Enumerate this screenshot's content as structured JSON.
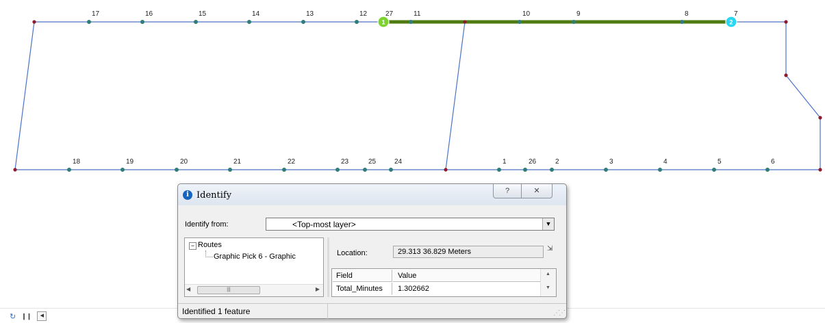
{
  "colors": {
    "network_line": "#4a73c9",
    "route": "#4e7a12",
    "node": "#2f7d75",
    "vertex": "#8c1c2e",
    "stop1": "#7dd32e",
    "stop2": "#2ad6f1"
  },
  "map": {
    "top_labels": [
      "17",
      "16",
      "15",
      "14",
      "13",
      "12",
      "27",
      "11",
      "10",
      "9",
      "8",
      "7"
    ],
    "bottom_labels": [
      "18",
      "19",
      "20",
      "21",
      "22",
      "23",
      "25",
      "24",
      "1",
      "26",
      "2",
      "3",
      "4",
      "5",
      "6"
    ],
    "stops": [
      {
        "label": "1"
      },
      {
        "label": "2"
      }
    ]
  },
  "identify": {
    "title": "Identify",
    "help_glyph": "?",
    "close_glyph": "✕",
    "from_label": "Identify from:",
    "from_value": "<Top-most layer>",
    "tree": {
      "root": "Routes",
      "child": "Graphic Pick 6 - Graphic"
    },
    "location_label": "Location:",
    "location_value": "29.313  36.829 Meters",
    "table": {
      "header_field": "Field",
      "header_value": "Value",
      "row_field": "Total_Minutes",
      "row_value": "1.302662"
    },
    "status": "Identified 1 feature"
  },
  "toolbar": {
    "refresh_icon": "refresh-icon",
    "pause_icon": "pause-icon",
    "back_icon": "back-arrow-icon"
  }
}
